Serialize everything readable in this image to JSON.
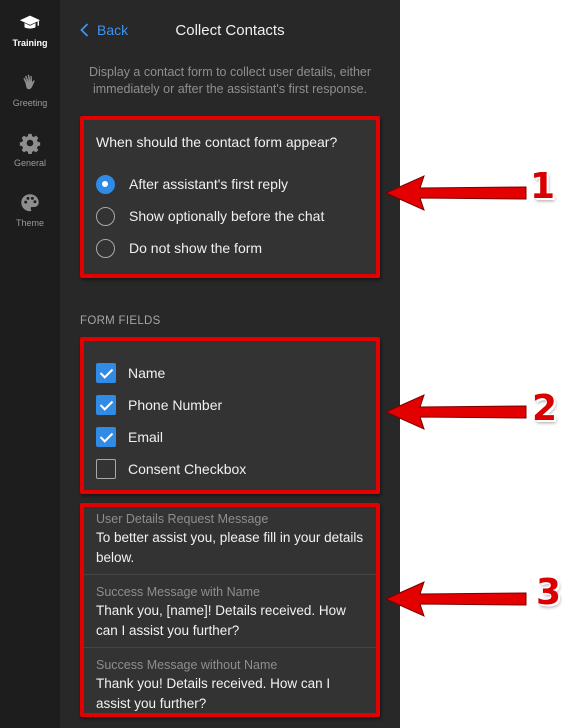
{
  "sidebar": {
    "items": [
      {
        "label": "Training",
        "icon": "graduation-cap-icon",
        "active": true
      },
      {
        "label": "Greeting",
        "icon": "waving-hand-icon",
        "active": false
      },
      {
        "label": "General",
        "icon": "gear-icon",
        "active": false
      },
      {
        "label": "Theme",
        "icon": "palette-icon",
        "active": false
      }
    ]
  },
  "header": {
    "back_label": "Back",
    "title": "Collect Contacts"
  },
  "description": "Display a contact form to collect user details, either immediately or after the assistant's first response.",
  "appearance": {
    "question": "When should the contact form appear?",
    "options": [
      {
        "label": "After assistant's first reply",
        "selected": true
      },
      {
        "label": "Show optionally before the chat",
        "selected": false
      },
      {
        "label": "Do not show the form",
        "selected": false
      }
    ]
  },
  "form_fields": {
    "section_label": "FORM FIELDS",
    "fields": [
      {
        "label": "Name",
        "checked": true
      },
      {
        "label": "Phone Number",
        "checked": true
      },
      {
        "label": "Email",
        "checked": true
      },
      {
        "label": "Consent Checkbox",
        "checked": false
      }
    ]
  },
  "messages": [
    {
      "label": "User Details Request Message",
      "value": "To better assist you, please fill in your details below."
    },
    {
      "label": "Success Message with Name",
      "value": "Thank you, [name]! Details received. How can I assist you further?"
    },
    {
      "label": "Success Message without Name",
      "value": "Thank you! Details received. How can I assist you further?"
    }
  ],
  "annotations": {
    "labels": [
      "1",
      "2",
      "3"
    ],
    "color": "#e20000"
  },
  "colors": {
    "accent": "#2f8be6",
    "panel_bg": "#282828",
    "rail_bg": "#1d1d1d"
  }
}
